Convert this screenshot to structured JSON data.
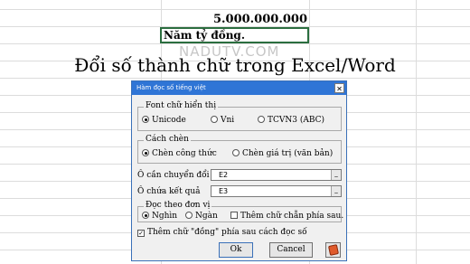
{
  "sheet": {
    "cell_value": "5.000.000.000",
    "cell_words": "Năm tỷ đồng.",
    "watermark": "NADUTV.COM",
    "headline": "Đổi số thành chữ trong Excel/Word"
  },
  "dialog": {
    "title": "Hàm đọc số tiếng việt",
    "close_glyph": "✕",
    "font_group": {
      "label": "Font chữ hiển thị",
      "options": [
        "Unicode",
        "Vni",
        "TCVN3 (ABC)"
      ],
      "selected": "Unicode"
    },
    "insert_group": {
      "label": "Cách chèn",
      "options": [
        "Chèn công thức",
        "Chèn giá trị (văn bản)"
      ],
      "selected": "Chèn công thức"
    },
    "source_cell": {
      "label": "Ô cần chuyển đổi",
      "value": "E2"
    },
    "result_cell": {
      "label": "Ô chứa kết quả",
      "value": "E3"
    },
    "unit_group": {
      "label": "Đọc theo đơn vị",
      "options": [
        "Nghìn",
        "Ngàn"
      ],
      "selected": "Nghìn",
      "suffix_check": "Thêm chữ chẵn phía sau."
    },
    "dong_check": {
      "label": "Thêm chữ \"đồng\" phía sau cách đọc   số",
      "checked": true
    },
    "ok_label": "Ok",
    "cancel_label": "Cancel",
    "help_icon": "help-book-icon"
  },
  "colors": {
    "titlebar": "#2f75d6",
    "cell_border": "#2b6e3f",
    "help_icon": "#e05a2b"
  }
}
